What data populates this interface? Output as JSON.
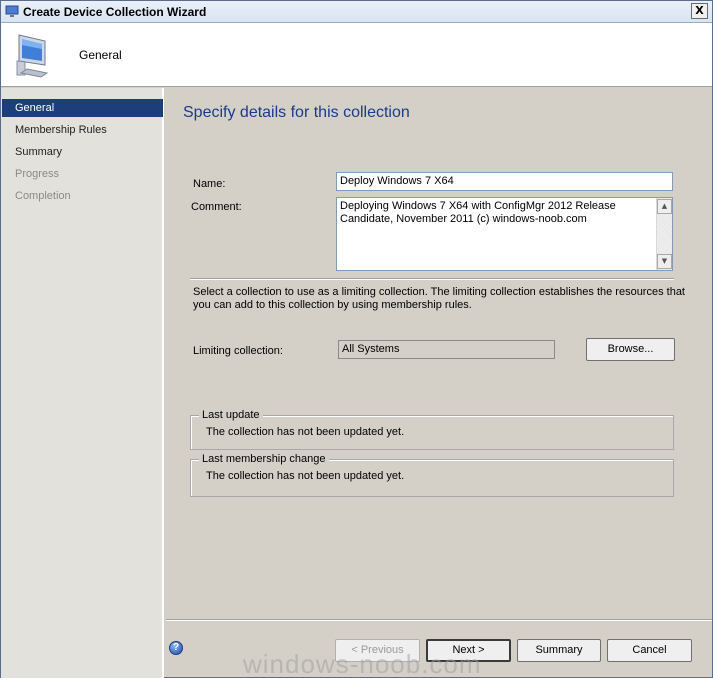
{
  "window": {
    "title": "Create Device Collection Wizard",
    "close_glyph": "X"
  },
  "header": {
    "title": "General",
    "icon": "computer-monitor-icon"
  },
  "nav": {
    "items": [
      {
        "label": "General",
        "state": "active"
      },
      {
        "label": "Membership Rules",
        "state": "normal"
      },
      {
        "label": "Summary",
        "state": "normal"
      },
      {
        "label": "Progress",
        "state": "disabled"
      },
      {
        "label": "Completion",
        "state": "disabled"
      }
    ]
  },
  "main": {
    "heading": "Specify details for this collection",
    "name_label": "Name:",
    "name_value": "Deploy Windows 7 X64",
    "comment_label": "Comment:",
    "comment_value": "Deploying Windows 7 X64 with ConfigMgr 2012 Release Candidate, November 2011 (c) windows-noob.com",
    "limiting_desc": "Select a collection to use as a limiting collection. The limiting collection establishes the resources that you can add to this collection by using membership rules.",
    "limiting_label": "Limiting collection:",
    "limiting_value": "All Systems",
    "browse_label": "Browse...",
    "last_update": {
      "legend": "Last update",
      "text": "The collection has not been updated yet."
    },
    "last_membership_change": {
      "legend": "Last membership change",
      "text": "The collection has not been updated yet."
    }
  },
  "footer": {
    "help_glyph": "?",
    "previous_label": "< Previous",
    "next_label": "Next >",
    "summary_label": "Summary",
    "cancel_label": "Cancel"
  },
  "watermark": "windows-noob.com",
  "colors": {
    "nav_active_bg": "#1c3f7a",
    "heading": "#1a3a8a",
    "window_bg": "#d4d0c8"
  }
}
